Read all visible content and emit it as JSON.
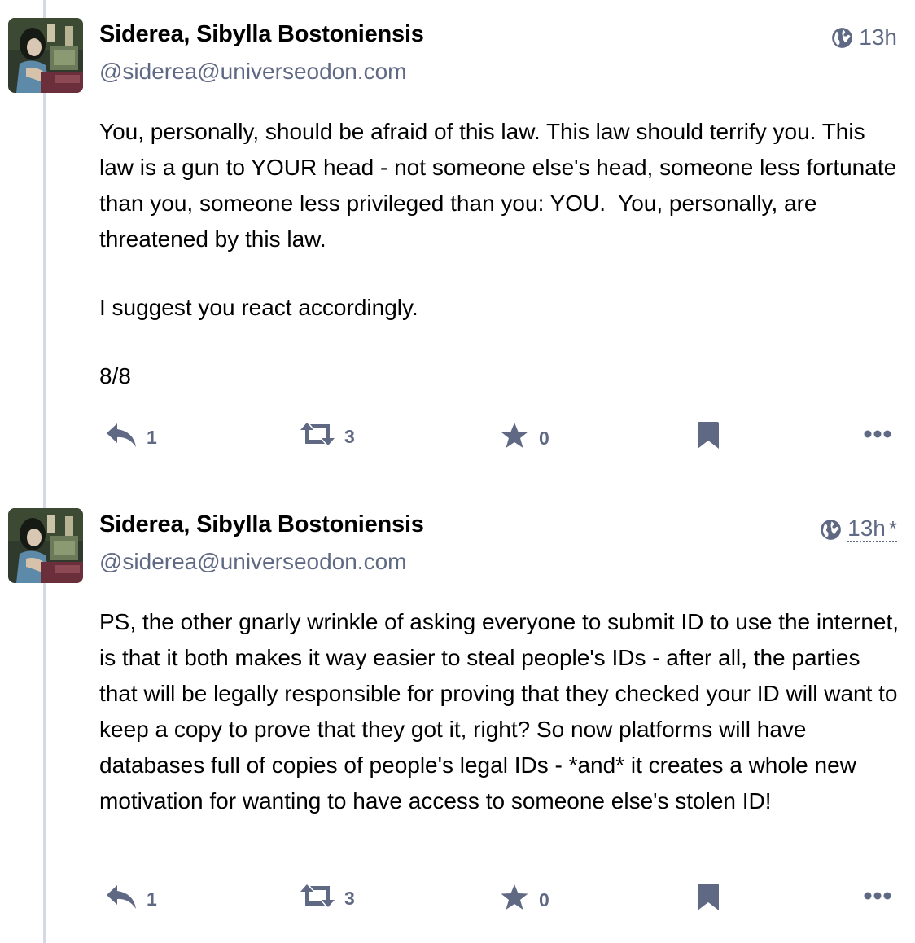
{
  "posts": [
    {
      "display_name": "Siderea, Sibylla Bostoniensis",
      "acct": "@siderea@universeodon.com",
      "visibility_icon": "globe-icon",
      "time": "13h",
      "edited_marker": "",
      "paragraphs": [
        "You, personally, should be afraid of this law. This law should terrify you. This law is a gun to YOUR head - not someone else's head, someone less fortunate than you, someone less privileged than you: YOU.  You, personally, are threatened by this law.",
        "I suggest you react accordingly.",
        "8/8"
      ],
      "actions": {
        "replies": "1",
        "boosts": "3",
        "favourites": "0"
      }
    },
    {
      "display_name": "Siderea, Sibylla Bostoniensis",
      "acct": "@siderea@universeodon.com",
      "visibility_icon": "globe-icon",
      "time": "13h",
      "edited_marker": "*",
      "paragraphs": [
        "PS, the other gnarly wrinkle of asking everyone to submit ID to use the internet, is that it both makes it way easier to steal people's IDs - after all, the parties that will be legally responsible for proving that they checked your ID will want to keep a copy to prove that they got it, right? So now platforms will have databases full of copies of people's legal IDs - *and* it creates a whole new motivation for wanting to have access to someone else's stolen ID!"
      ],
      "actions": {
        "replies": "1",
        "boosts": "3",
        "favourites": "0"
      }
    }
  ],
  "colors": {
    "text": "#000000",
    "secondary": "#606984",
    "thread_line": "#d5d9e6",
    "background": "#ffffff"
  }
}
